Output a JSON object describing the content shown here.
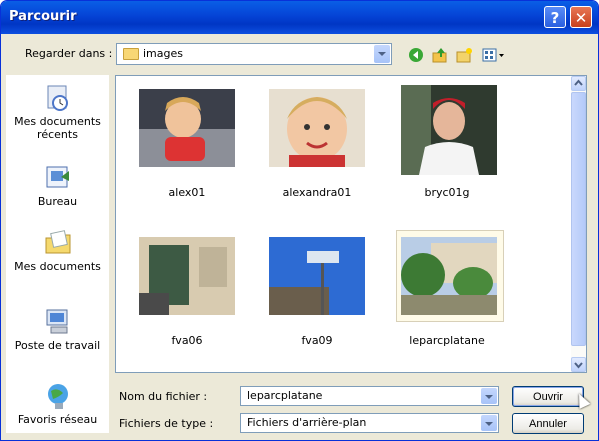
{
  "window": {
    "title": "Parcourir",
    "help_icon": "?",
    "close_icon": "✕"
  },
  "lookin": {
    "label": "Regarder dans :",
    "value": "images"
  },
  "toolbar_icons": [
    "back-icon",
    "up-folder-icon",
    "new-folder-icon",
    "view-menu-icon"
  ],
  "places": [
    {
      "label": "Mes documents récents",
      "icon": "recent-documents-icon"
    },
    {
      "label": "Bureau",
      "icon": "desktop-icon"
    },
    {
      "label": "Mes documents",
      "icon": "my-documents-icon"
    },
    {
      "label": "Poste de travail",
      "icon": "my-computer-icon"
    },
    {
      "label": "Favoris réseau",
      "icon": "network-places-icon"
    }
  ],
  "files": [
    {
      "name": "alex01"
    },
    {
      "name": "alexandra01"
    },
    {
      "name": "bryc01g"
    },
    {
      "name": "fva06"
    },
    {
      "name": "fva09"
    },
    {
      "name": "leparcplatane"
    }
  ],
  "filename": {
    "label": "Nom du fichier :",
    "value": "leparcplatane"
  },
  "filetype": {
    "label": "Fichiers de type :",
    "value": "Fichiers d'arrière-plan"
  },
  "buttons": {
    "open": "Ouvrir",
    "cancel": "Annuler"
  }
}
